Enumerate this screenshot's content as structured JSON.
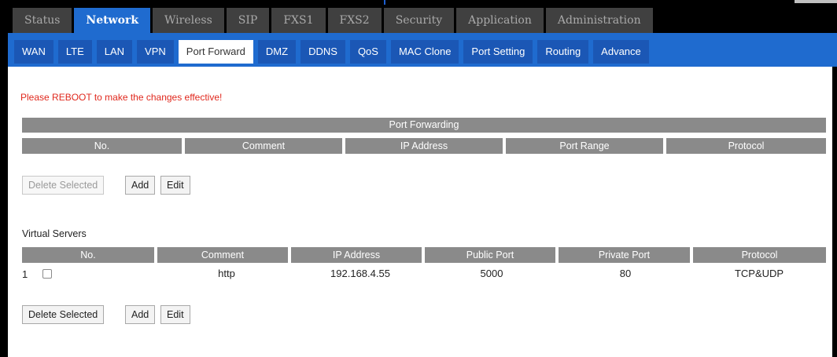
{
  "main_tabs": [
    "Status",
    "Network",
    "Wireless",
    "SIP",
    "FXS1",
    "FXS2",
    "Security",
    "Application",
    "Administration"
  ],
  "main_active": "Network",
  "sub_tabs": [
    "WAN",
    "LTE",
    "LAN",
    "VPN",
    "Port Forward",
    "DMZ",
    "DDNS",
    "QoS",
    "MAC Clone",
    "Port Setting",
    "Routing",
    "Advance"
  ],
  "sub_active": "Port Forward",
  "reboot_notice": "Please REBOOT to make the changes effective!",
  "port_forwarding": {
    "title": "Port Forwarding",
    "columns": [
      "No.",
      "Comment",
      "IP Address",
      "Port Range",
      "Protocol"
    ],
    "buttons": {
      "delete": "Delete Selected",
      "add": "Add",
      "edit": "Edit"
    }
  },
  "virtual_servers": {
    "title": "Virtual Servers",
    "columns": [
      "No.",
      "Comment",
      "IP Address",
      "Public Port",
      "Private Port",
      "Protocol"
    ],
    "rows": [
      {
        "no": "1",
        "comment": "http",
        "ip": "192.168.4.55",
        "public_port": "5000",
        "private_port": "80",
        "protocol": "TCP&UDP"
      }
    ],
    "buttons": {
      "delete": "Delete Selected",
      "add": "Add",
      "edit": "Edit"
    }
  },
  "colors": {
    "accent_blue": "#1f6bcf",
    "header_gray": "#8a8a8a",
    "notice_red": "#e0281d"
  }
}
